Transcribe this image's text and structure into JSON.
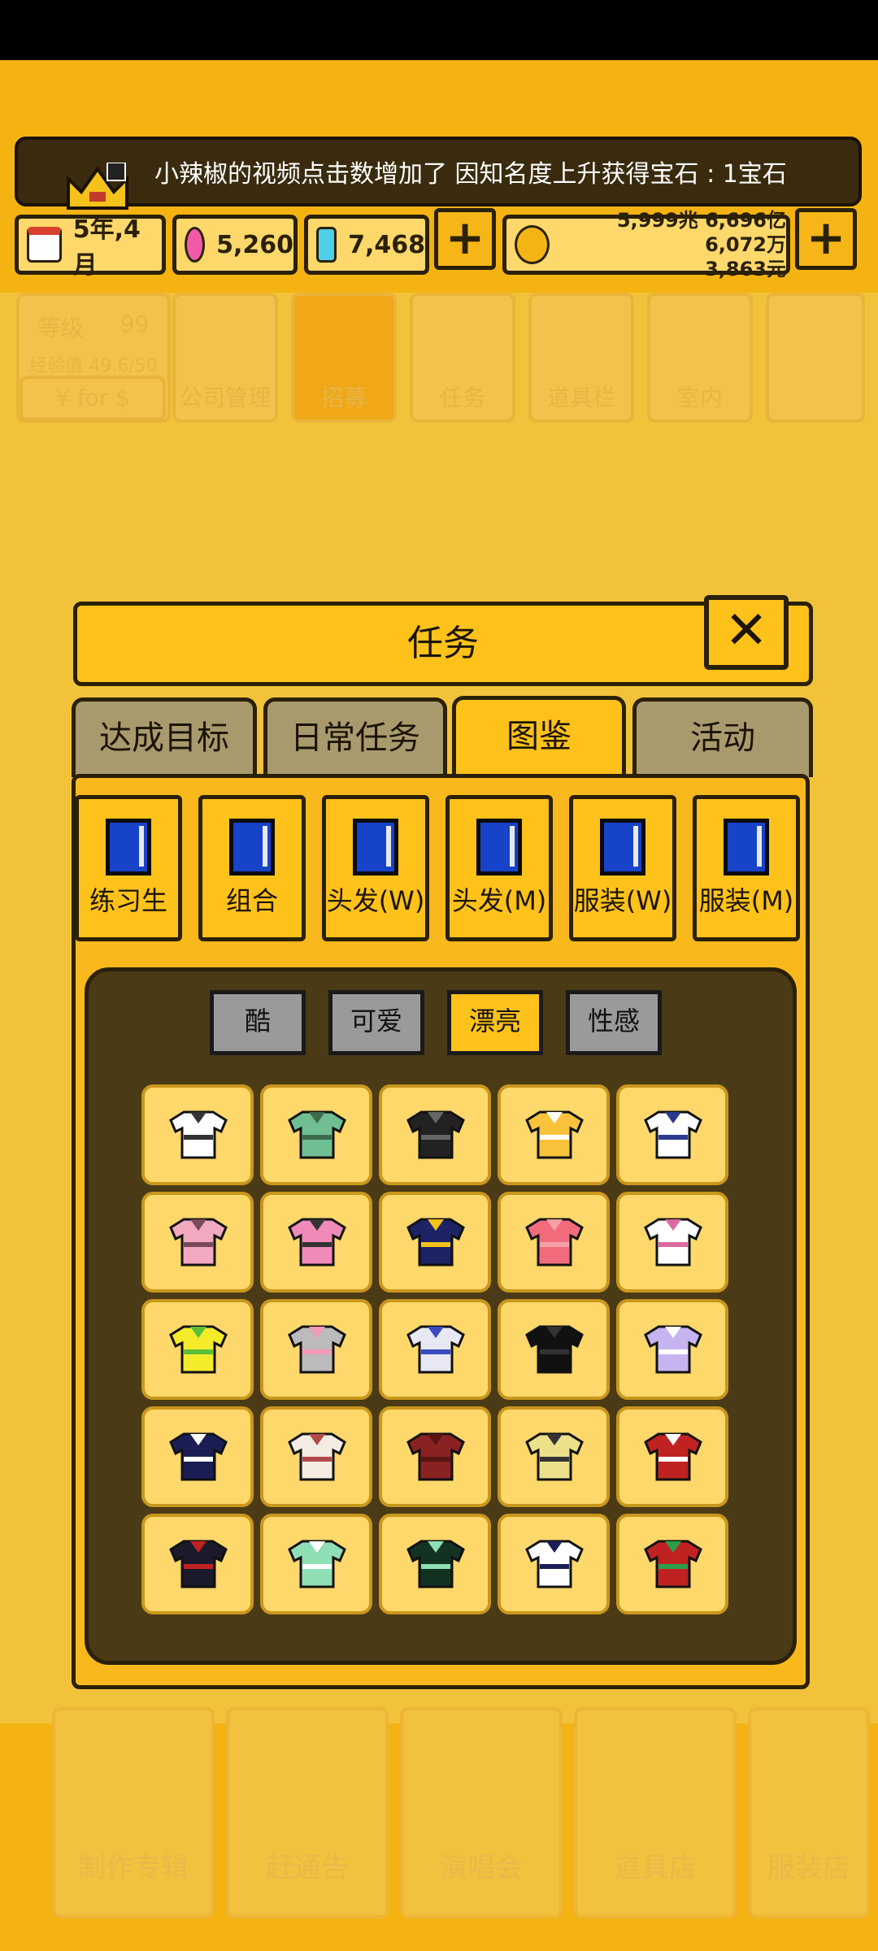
{
  "ticker": {
    "text": "小辣椒的视频点击数增加了 因知名度上升获得宝石 : 1宝石"
  },
  "resources": {
    "date": "5年,4月",
    "pink_gems": "5,260",
    "blue_gems": "7,468",
    "money_line1": "5,999兆 6,696亿 6,072万",
    "money_line2": "3,863元",
    "plus_label": "+"
  },
  "background": {
    "level_label": "等级",
    "level_value": "99",
    "exp_label": "经验值",
    "exp_value": "49.6/50",
    "currency_btn": "¥ for $",
    "menu": [
      "公司管理",
      "招募",
      "任务",
      "道具栏",
      "室内"
    ],
    "bottom": [
      "制作专辑",
      "赶通告",
      "演唱会",
      "道具店",
      "服装店"
    ]
  },
  "modal": {
    "title": "任务",
    "close": "✕",
    "tabs": [
      "达成目标",
      "日常任务",
      "图鉴",
      "活动"
    ],
    "active_tab": "图鉴",
    "categories": [
      "练习生",
      "组合",
      "头发(W)",
      "头发(M)",
      "服装(W)",
      "服装(M)"
    ],
    "styles": [
      "酷",
      "可爱",
      "漂亮",
      "性感"
    ],
    "active_style": "漂亮",
    "items": [
      {
        "icon": "white-mesh-top",
        "color": "#FFFFFF",
        "accent": "#333333"
      },
      {
        "icon": "green-jacket",
        "color": "#6FBF92",
        "accent": "#3E6B4E"
      },
      {
        "icon": "black-jacket",
        "color": "#222222",
        "accent": "#666666"
      },
      {
        "icon": "yellow-v-top",
        "color": "#F8C33A",
        "accent": "#FFFFFF"
      },
      {
        "icon": "navy-striped-top",
        "color": "#FFFFFF",
        "accent": "#2A3A8E"
      },
      {
        "icon": "pink-top",
        "color": "#F3A9C0",
        "accent": "#7A4A5A"
      },
      {
        "icon": "pink-bow-jacket",
        "color": "#F08AB8",
        "accent": "#333333"
      },
      {
        "icon": "navy-gold-jacket",
        "color": "#1C2466",
        "accent": "#F5C21A"
      },
      {
        "icon": "coral-striped-top",
        "color": "#F06C7C",
        "accent": "#F5A0A8"
      },
      {
        "icon": "white-lace-top",
        "color": "#FFFFFF",
        "accent": "#D96BA0"
      },
      {
        "icon": "yellow-green-top",
        "color": "#F4EC2A",
        "accent": "#5BBF3A"
      },
      {
        "icon": "grey-pink-top",
        "color": "#BBBBBB",
        "accent": "#F29AB8"
      },
      {
        "icon": "white-floral-top",
        "color": "#E8E8F4",
        "accent": "#3A4ABF"
      },
      {
        "icon": "black-top",
        "color": "#111111",
        "accent": "#333333"
      },
      {
        "icon": "lavender-top",
        "color": "#C6B4F0",
        "accent": "#FFFFFF"
      },
      {
        "icon": "navy-sailor-top",
        "color": "#1A1E55",
        "accent": "#FFFFFF"
      },
      {
        "icon": "cream-ruffle-top",
        "color": "#F5EDE4",
        "accent": "#B24A4A"
      },
      {
        "icon": "maroon-jacket",
        "color": "#8A2222",
        "accent": "#5A1414"
      },
      {
        "icon": "khaki-top",
        "color": "#ECE08A",
        "accent": "#333333"
      },
      {
        "icon": "red-white-top",
        "color": "#C02222",
        "accent": "#FFFFFF"
      },
      {
        "icon": "black-red-bow-top",
        "color": "#1A1A2A",
        "accent": "#C02222"
      },
      {
        "icon": "mint-top",
        "color": "#8EE0B4",
        "accent": "#FFFFFF"
      },
      {
        "icon": "black-mint-jacket",
        "color": "#123222",
        "accent": "#8EE0B4"
      },
      {
        "icon": "white-navy-top",
        "color": "#FFFFFF",
        "accent": "#1A1E55"
      },
      {
        "icon": "red-green-xmas-top",
        "color": "#C02222",
        "accent": "#2AA04A"
      }
    ]
  }
}
